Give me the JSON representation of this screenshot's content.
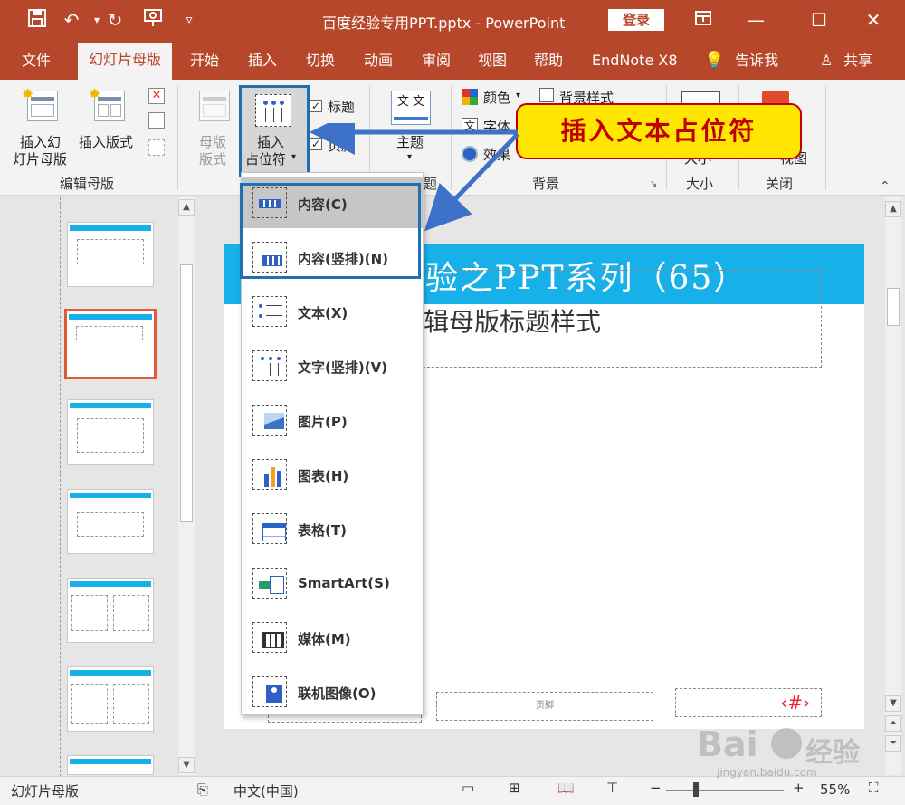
{
  "window": {
    "title": "百度经验专用PPT.pptx  -  PowerPoint",
    "login": "登录"
  },
  "tabs": [
    "文件",
    "幻灯片母版",
    "开始",
    "插入",
    "切换",
    "动画",
    "审阅",
    "视图",
    "帮助",
    "EndNote X8",
    "告诉我",
    "共享"
  ],
  "ribbon": {
    "insert_master": "插入幻\n灯片母版",
    "insert_master_l1": "插入幻",
    "insert_master_l2": "灯片母版",
    "insert_layout": "插入版式",
    "group_edit": "编辑母版",
    "master_layout_l1": "母版",
    "master_layout_l2": "版式",
    "insert_placeholder_l1": "插入",
    "insert_placeholder_l2": "占位符",
    "title_chk": "标题",
    "footer_chk": "页脚",
    "theme": "主题",
    "colors": "颜色",
    "fonts": "字体",
    "effects": "效果",
    "bg_styles": "背景样式",
    "group_bg": "背景",
    "group_size": "大小",
    "group_close": "关闭",
    "group_theme_tail": "题",
    "size_btn": "大小",
    "close_btn": "视图"
  },
  "callout": "插入文本占位符",
  "menu_items": [
    {
      "label": "内容(C)",
      "icon": "content-icon"
    },
    {
      "label": "内容(竖排)(N)",
      "icon": "content-vertical-icon"
    },
    {
      "label": "文本(X)",
      "icon": "text-icon"
    },
    {
      "label": "文字(竖排)(V)",
      "icon": "text-vertical-icon"
    },
    {
      "label": "图片(P)",
      "icon": "picture-icon"
    },
    {
      "label": "图表(H)",
      "icon": "chart-icon"
    },
    {
      "label": "表格(T)",
      "icon": "table-icon"
    },
    {
      "label": "SmartArt(S)",
      "icon": "smartart-icon"
    },
    {
      "label": "媒体(M)",
      "icon": "media-icon"
    },
    {
      "label": "联机图像(O)",
      "icon": "online-image-icon"
    }
  ],
  "slide": {
    "title": "验之PPT系列（65）",
    "subtitle": "辑母版标题样式",
    "footer": "页脚",
    "page_num": "‹#›"
  },
  "statusbar": {
    "view": "幻灯片母版",
    "lang": "中文(中国)",
    "zoom": "55%"
  },
  "watermark": {
    "brand": "Bai",
    "brand2": "经验",
    "url": "jingyan.baidu.com"
  },
  "colors": {
    "accent": "#b7472a",
    "slide_band": "#17b0e8",
    "highlight": "#1f6fb3",
    "callout_bg": "#ffe600",
    "callout_text": "#c00000"
  }
}
